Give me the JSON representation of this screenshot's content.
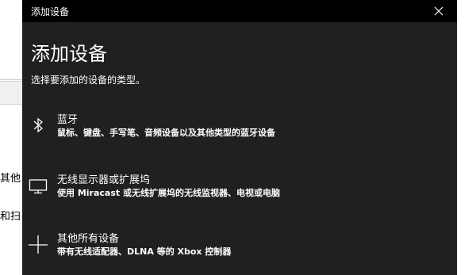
{
  "background": {
    "text_lines": [
      "其他",
      "和扫"
    ]
  },
  "dialog": {
    "window_title": "添加设备",
    "heading": "添加设备",
    "subtitle": "选择要添加的设备的类型。",
    "options": [
      {
        "icon": "bluetooth-icon",
        "label": "蓝牙",
        "description": "鼠标、键盘、手写笔、音频设备以及其他类型的蓝牙设备"
      },
      {
        "icon": "monitor-icon",
        "label": "无线显示器或扩展坞",
        "description": "使用 Miracast 或无线扩展坞的无线监视器、电视或电脑"
      },
      {
        "icon": "plus-icon",
        "label": "其他所有设备",
        "description": "带有无线适配器、DLNA 等的 Xbox 控制器"
      }
    ]
  },
  "colors": {
    "dialog_bg": "#202020",
    "titlebar_bg": "#000000",
    "text": "#ffffff"
  }
}
